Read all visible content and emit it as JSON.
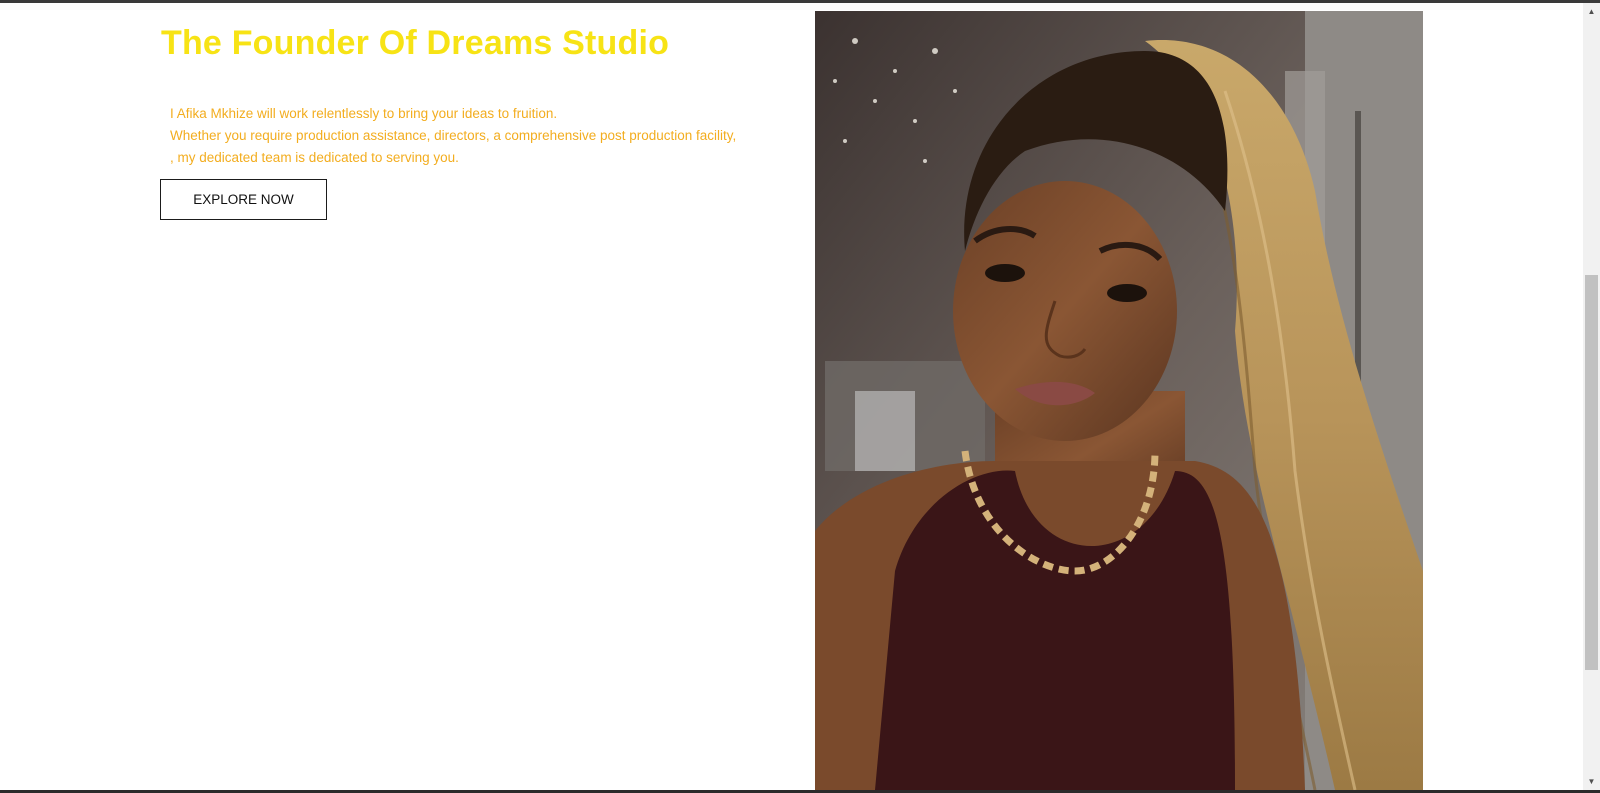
{
  "hero": {
    "title": "The Founder Of Dreams Studio",
    "intro_lines": [
      "I Afika Mkhize will work relentlessly to bring your ideas to fruition.",
      "Whether you require production assistance, directors, a comprehensive post production facility,",
      ", my dedicated team is dedicated to serving you."
    ],
    "cta_label": "EXPLORE NOW"
  },
  "colors": {
    "title": "#f7e315",
    "intro_text": "#f3ad1f",
    "button_border": "#1b1b1b"
  },
  "scrollbar": {
    "up_icon": "scroll-up-arrow",
    "down_icon": "scroll-down-arrow"
  }
}
